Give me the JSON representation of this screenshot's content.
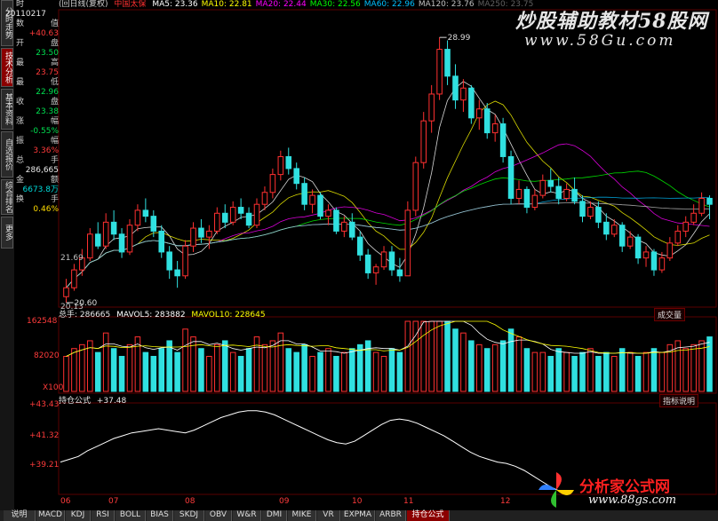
{
  "side_tabs": [
    {
      "label": "分时走势",
      "active": false
    },
    {
      "label": "技术分析",
      "active": true
    },
    {
      "label": "基本资料",
      "active": false
    },
    {
      "label": "自选报价",
      "active": false
    },
    {
      "label": "综合排名",
      "active": false
    },
    {
      "label": "更多",
      "active": false
    }
  ],
  "info": {
    "corner": "时",
    "date": "20110217",
    "rows": [
      {
        "label": "数",
        "value": "值",
        "color": "#c8c8c8"
      },
      {
        "label": "",
        "value": "+40.63",
        "color": "#ff3b3b"
      },
      {
        "label": "开",
        "value": "盘",
        "color": "#c8c8c8"
      },
      {
        "label": "",
        "value": "23.50",
        "color": "#00e050"
      },
      {
        "label": "最",
        "value": "高",
        "color": "#c8c8c8"
      },
      {
        "label": "",
        "value": "23.75",
        "color": "#ff3b3b"
      },
      {
        "label": "最",
        "value": "低",
        "color": "#c8c8c8"
      },
      {
        "label": "",
        "value": "22.96",
        "color": "#00e050"
      },
      {
        "label": "收",
        "value": "盘",
        "color": "#c8c8c8"
      },
      {
        "label": "",
        "value": "23.38",
        "color": "#00e050"
      },
      {
        "label": "涨",
        "value": "幅",
        "color": "#c8c8c8"
      },
      {
        "label": "",
        "value": "-0.55%",
        "color": "#00e050"
      },
      {
        "label": "振",
        "value": "幅",
        "color": "#c8c8c8"
      },
      {
        "label": "",
        "value": "3.36%",
        "color": "#ff3b3b"
      },
      {
        "label": "总",
        "value": "手",
        "color": "#c8c8c8"
      },
      {
        "label": "",
        "value": "286,665",
        "color": "#e8e8e8"
      },
      {
        "label": "金",
        "value": "额",
        "color": "#c8c8c8"
      },
      {
        "label": "",
        "value": "6673.8万",
        "color": "#00dcdc"
      },
      {
        "label": "换",
        "value": "手",
        "color": "#c8c8c8"
      },
      {
        "label": "",
        "value": "0.46%",
        "color": "#ffdc00"
      }
    ]
  },
  "header": {
    "title": "(回日线(复权)",
    "name": "中国太保",
    "ma": [
      {
        "label": "MA5: 23.36",
        "color": "#ffffff"
      },
      {
        "label": "MA10: 22.81",
        "color": "#ffff00"
      },
      {
        "label": "MA20: 22.44",
        "color": "#ff00ff"
      },
      {
        "label": "MA30: 22.56",
        "color": "#00ff00"
      },
      {
        "label": "MA60: 22.96",
        "color": "#00c0ff"
      },
      {
        "label": "MA120: 23.76",
        "color": "#c0c0c0"
      },
      {
        "label": "MA250: 23.75",
        "color": "#606060"
      }
    ]
  },
  "watermark": {
    "line1": "炒股辅助教材58股网",
    "line2": "www.58Gu.com"
  },
  "price_axis": {
    "labels": [
      {
        "text": "21.69",
        "v": 21.69
      },
      {
        "text": "20.13",
        "v": 20.13
      }
    ]
  },
  "price_annotations": {
    "high": "28.99",
    "low": "20.60"
  },
  "volume": {
    "header": [
      {
        "label": "总手: 286665",
        "color": "#e8e8e8"
      },
      {
        "label": "MAVOL5: 283882",
        "color": "#ffffff"
      },
      {
        "label": "MAVOL10: 228645",
        "color": "#ffff00"
      }
    ],
    "axis": [
      "162548",
      "82020",
      "X100"
    ],
    "tag": "成交量"
  },
  "indicator": {
    "header": [
      {
        "label": "持仓公式",
        "color": "#e8e8e8"
      },
      {
        "label": "+37.48",
        "color": "#e8e8e8"
      }
    ],
    "axis": [
      "+43.43",
      "+41.32",
      "+39.21"
    ],
    "tag": "指标说明"
  },
  "x_axis": [
    "06",
    "07",
    "08",
    "09",
    "10",
    "11",
    "12"
  ],
  "bottom_tabs": [
    {
      "label": "说明",
      "active": false
    },
    {
      "label": "MACD",
      "active": false
    },
    {
      "label": "KDJ",
      "active": false
    },
    {
      "label": "RSI",
      "active": false
    },
    {
      "label": "BOLL",
      "active": false
    },
    {
      "label": "BIAS",
      "active": false
    },
    {
      "label": "SKDJ",
      "active": false
    },
    {
      "label": "OBV",
      "active": false
    },
    {
      "label": "W&R",
      "active": false
    },
    {
      "label": "DMI",
      "active": false
    },
    {
      "label": "MIKE",
      "active": false
    },
    {
      "label": "VR",
      "active": false
    },
    {
      "label": "EXPMA",
      "active": false
    },
    {
      "label": "ARBR",
      "active": false
    },
    {
      "label": "持仓公式",
      "active": true
    }
  ],
  "logo": {
    "line1": "分析家公式网",
    "line2": "www.88gs.com"
  },
  "chart_data": {
    "type": "candlestick",
    "price_range": [
      20.13,
      29.6
    ],
    "candles": [
      [
        20.3,
        20.9,
        20.1,
        20.6
      ],
      [
        20.6,
        21.4,
        20.5,
        21.2
      ],
      [
        21.2,
        21.9,
        21.0,
        21.6
      ],
      [
        21.6,
        22.6,
        21.5,
        22.4
      ],
      [
        22.4,
        22.8,
        21.9,
        22.0
      ],
      [
        22.0,
        23.1,
        21.9,
        22.8
      ],
      [
        22.8,
        23.2,
        22.2,
        22.4
      ],
      [
        22.4,
        22.6,
        21.6,
        21.8
      ],
      [
        21.8,
        22.9,
        21.7,
        22.7
      ],
      [
        22.7,
        23.4,
        22.5,
        23.2
      ],
      [
        23.2,
        23.6,
        22.8,
        23.0
      ],
      [
        23.0,
        23.2,
        22.3,
        22.5
      ],
      [
        22.5,
        22.7,
        21.6,
        21.8
      ],
      [
        21.8,
        22.0,
        20.9,
        21.2
      ],
      [
        21.2,
        21.5,
        20.6,
        21.0
      ],
      [
        21.0,
        22.2,
        20.9,
        22.0
      ],
      [
        22.0,
        22.8,
        21.8,
        22.6
      ],
      [
        22.6,
        22.9,
        22.1,
        22.3
      ],
      [
        22.3,
        22.7,
        21.9,
        22.5
      ],
      [
        22.5,
        23.3,
        22.4,
        23.1
      ],
      [
        23.1,
        23.4,
        22.6,
        22.8
      ],
      [
        22.8,
        23.5,
        22.7,
        23.3
      ],
      [
        23.3,
        23.6,
        22.9,
        23.1
      ],
      [
        23.1,
        23.3,
        22.6,
        22.7
      ],
      [
        22.7,
        23.6,
        22.6,
        23.4
      ],
      [
        23.4,
        24.0,
        23.2,
        23.8
      ],
      [
        23.8,
        24.6,
        23.6,
        24.4
      ],
      [
        24.4,
        25.2,
        24.2,
        25.0
      ],
      [
        25.0,
        25.3,
        24.4,
        24.6
      ],
      [
        24.6,
        24.8,
        23.9,
        24.1
      ],
      [
        24.1,
        24.3,
        23.2,
        23.4
      ],
      [
        23.4,
        23.9,
        23.1,
        23.7
      ],
      [
        23.7,
        23.8,
        22.9,
        23.0
      ],
      [
        23.0,
        23.4,
        22.7,
        23.2
      ],
      [
        23.2,
        23.3,
        22.4,
        22.5
      ],
      [
        22.5,
        23.0,
        22.3,
        22.8
      ],
      [
        22.8,
        23.1,
        22.2,
        22.3
      ],
      [
        22.3,
        22.5,
        21.5,
        21.7
      ],
      [
        21.7,
        21.9,
        20.9,
        21.1
      ],
      [
        21.1,
        21.4,
        20.7,
        21.3
      ],
      [
        21.3,
        22.0,
        21.2,
        21.8
      ],
      [
        21.8,
        22.0,
        21.0,
        21.2
      ],
      [
        21.2,
        21.6,
        20.8,
        21.0
      ],
      [
        21.0,
        23.5,
        21.0,
        23.2
      ],
      [
        23.2,
        25.0,
        23.0,
        24.8
      ],
      [
        24.8,
        26.5,
        24.6,
        26.2
      ],
      [
        26.2,
        27.4,
        25.8,
        27.1
      ],
      [
        27.1,
        29.0,
        26.9,
        28.6
      ],
      [
        28.6,
        28.9,
        27.4,
        27.7
      ],
      [
        27.7,
        28.1,
        26.6,
        26.9
      ],
      [
        26.9,
        27.6,
        26.5,
        27.3
      ],
      [
        27.3,
        27.4,
        26.1,
        26.3
      ],
      [
        26.3,
        26.9,
        25.9,
        26.6
      ],
      [
        26.6,
        26.8,
        25.6,
        25.8
      ],
      [
        25.8,
        26.4,
        25.5,
        26.1
      ],
      [
        26.1,
        26.3,
        24.8,
        25.0
      ],
      [
        25.0,
        25.2,
        23.4,
        23.6
      ],
      [
        23.6,
        24.2,
        23.4,
        23.9
      ],
      [
        23.9,
        24.0,
        23.1,
        23.3
      ],
      [
        23.3,
        23.9,
        23.2,
        23.7
      ],
      [
        23.7,
        24.4,
        23.6,
        24.2
      ],
      [
        24.2,
        24.6,
        23.8,
        24.0
      ],
      [
        24.0,
        24.3,
        23.4,
        23.6
      ],
      [
        23.6,
        24.1,
        23.5,
        23.9
      ],
      [
        23.9,
        24.3,
        23.4,
        23.5
      ],
      [
        23.5,
        23.7,
        22.8,
        23.0
      ],
      [
        23.0,
        23.5,
        22.9,
        23.3
      ],
      [
        23.3,
        23.5,
        22.6,
        22.8
      ],
      [
        22.8,
        23.1,
        22.2,
        22.4
      ],
      [
        22.4,
        22.9,
        22.3,
        22.7
      ],
      [
        22.7,
        22.8,
        21.8,
        22.0
      ],
      [
        22.0,
        22.5,
        21.9,
        22.3
      ],
      [
        22.3,
        22.4,
        21.4,
        21.6
      ],
      [
        21.6,
        22.0,
        21.3,
        21.8
      ],
      [
        21.8,
        21.9,
        21.0,
        21.2
      ],
      [
        21.2,
        21.8,
        21.1,
        21.6
      ],
      [
        21.6,
        22.3,
        21.5,
        22.1
      ],
      [
        22.1,
        22.7,
        22.0,
        22.5
      ],
      [
        22.5,
        23.0,
        22.3,
        22.8
      ],
      [
        22.8,
        23.4,
        22.7,
        23.1
      ],
      [
        23.1,
        23.8,
        23.0,
        23.6
      ],
      [
        23.6,
        23.7,
        22.9,
        23.4
      ]
    ],
    "volume_values": [
      900,
      1100,
      1200,
      1300,
      1000,
      1500,
      1100,
      900,
      1200,
      1400,
      1000,
      900,
      1100,
      1300,
      1000,
      1600,
      1400,
      1100,
      900,
      1200,
      1300,
      1000,
      900,
      1100,
      1400,
      1200,
      1300,
      1500,
      1100,
      1000,
      1200,
      900,
      1000,
      1100,
      900,
      1000,
      1100,
      1200,
      1300,
      1000,
      900,
      1100,
      1000,
      1800,
      2400,
      2600,
      2500,
      2200,
      1900,
      1600,
      1500,
      1300,
      1200,
      1100,
      1200,
      1300,
      1600,
      1400,
      1100,
      1000,
      1000,
      900,
      1100,
      1000,
      900,
      1000,
      1100,
      900,
      1000,
      900,
      1100,
      1000,
      900,
      1000,
      1100,
      1000,
      1200,
      1300,
      1100,
      1200,
      1300,
      1400
    ],
    "volume_range": [
      0,
      1800
    ],
    "indicator_values": [
      39.6,
      39.8,
      40.0,
      40.4,
      40.7,
      41.0,
      41.3,
      41.5,
      41.7,
      41.8,
      41.9,
      42.0,
      41.9,
      41.8,
      41.7,
      41.9,
      42.2,
      42.5,
      42.8,
      43.0,
      43.2,
      43.3,
      43.3,
      43.2,
      43.0,
      42.7,
      42.4,
      42.1,
      41.8,
      41.5,
      41.2,
      41.0,
      40.9,
      41.1,
      41.5,
      41.9,
      42.3,
      42.6,
      42.7,
      42.6,
      42.4,
      42.1,
      41.8,
      41.5,
      41.1,
      40.7,
      40.3,
      40.0,
      39.8,
      39.6,
      39.5,
      39.3,
      39.0,
      38.6,
      38.2,
      37.8,
      37.5
    ],
    "indicator_range": [
      37.4,
      43.6
    ]
  }
}
